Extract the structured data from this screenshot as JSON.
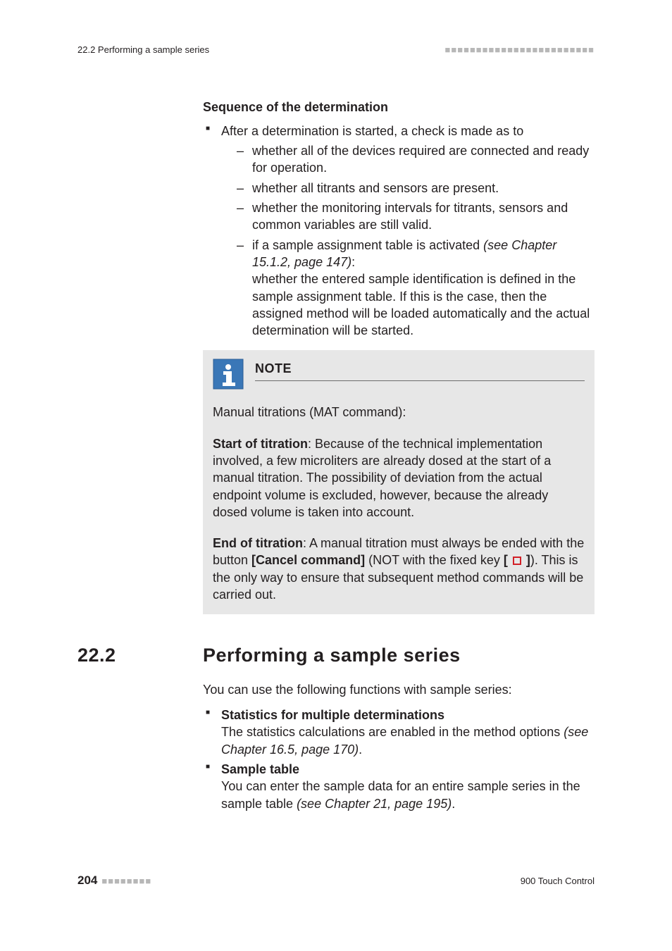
{
  "header": {
    "left": "22.2 Performing a sample series",
    "squares_right": "■■■■■■■■■■■■■■■■■■■■■■■■"
  },
  "seq": {
    "heading": "Sequence of the determination",
    "intro": "After a determination is started, a check is made as to",
    "checks": {
      "c1": "whether all of the devices required are connected and ready for operation.",
      "c2": "whether all titrants and sensors are present.",
      "c3": "whether the monitoring intervals for titrants, sensors and common variables are still valid.",
      "c4_pre": "if a sample assignment table is activated ",
      "c4_ref": "(see Chapter 15.1.2, page 147)",
      "c4_colon": ":",
      "c4_body": "whether the entered sample identification is defined in the sample assignment table. If this is the case, then the assigned method will be loaded automatically and the actual determination will be started."
    }
  },
  "note": {
    "title": "NOTE",
    "line1": "Manual titrations (MAT command):",
    "start_label": "Start of titration",
    "start_body": ": Because of the technical implementation involved, a few microliters are already dosed at the start of a manual titration. The possibility of deviation from the actual endpoint volume is excluded, however, because the already dosed volume is taken into account.",
    "end_label": "End of titration",
    "end_body_1": ": A manual titration must always be ended with the button ",
    "end_button": "[Cancel command]",
    "end_body_2": " (NOT with the fixed key ",
    "end_key_open": "[ ",
    "end_key_close": " ]",
    "end_body_3": "). This is the only way to ensure that subsequent method commands will be carried out."
  },
  "section": {
    "num": "22.2",
    "title": "Performing a sample series",
    "intro": "You can use the following functions with sample series:",
    "b1_label": "Statistics for multiple determinations",
    "b1_body_1": "The statistics calculations are enabled in the method options ",
    "b1_ref": "(see Chapter 16.5, page 170)",
    "b1_dot": ".",
    "b2_label": "Sample table",
    "b2_body_1": "You can enter the sample data for an entire sample series in the sample table ",
    "b2_ref": "(see Chapter 21, page 195)",
    "b2_dot": "."
  },
  "footer": {
    "page": "204",
    "squares_left": "■■■■■■■■",
    "product": "900 Touch Control"
  }
}
